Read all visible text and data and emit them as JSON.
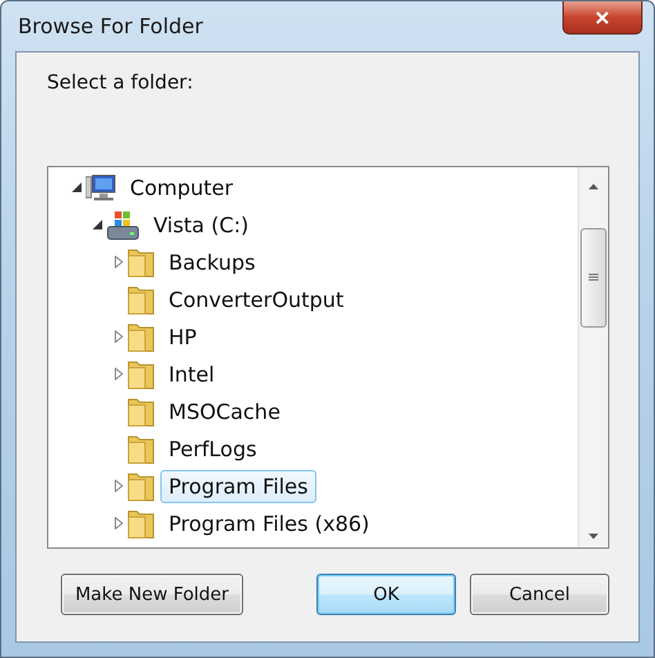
{
  "window": {
    "title": "Browse For Folder",
    "close": "✕"
  },
  "prompt": "Select a folder:",
  "tree": [
    {
      "label": "Computer",
      "kind": "computer",
      "expanded": true,
      "selected": false,
      "children": [
        {
          "label": "Vista (C:)",
          "kind": "drive",
          "expanded": true,
          "selected": false,
          "children": [
            {
              "label": "Backups",
              "kind": "folder",
              "expandable": true,
              "selected": false
            },
            {
              "label": "ConverterOutput",
              "kind": "folder",
              "expandable": false,
              "selected": false
            },
            {
              "label": "HP",
              "kind": "folder",
              "expandable": true,
              "selected": false
            },
            {
              "label": "Intel",
              "kind": "folder",
              "expandable": true,
              "selected": false
            },
            {
              "label": "MSOCache",
              "kind": "folder",
              "expandable": false,
              "selected": false
            },
            {
              "label": "PerfLogs",
              "kind": "folder",
              "expandable": false,
              "selected": false
            },
            {
              "label": "Program Files",
              "kind": "folder",
              "expandable": true,
              "selected": true
            },
            {
              "label": "Program Files (x86)",
              "kind": "folder",
              "expandable": true,
              "selected": false
            }
          ]
        }
      ]
    }
  ],
  "buttons": [
    {
      "label": "Make New Folder",
      "kind": "secondary"
    },
    {
      "label": "OK",
      "kind": "default"
    },
    {
      "label": "Cancel",
      "kind": "secondary"
    }
  ]
}
